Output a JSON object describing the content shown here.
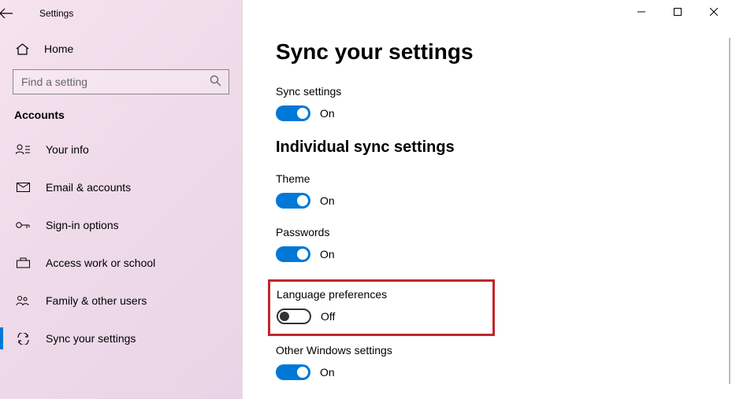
{
  "titlebar": {
    "title": "Settings"
  },
  "sidebar": {
    "home_label": "Home",
    "search_placeholder": "Find a setting",
    "section_label": "Accounts",
    "items": [
      {
        "label": "Your info"
      },
      {
        "label": "Email & accounts"
      },
      {
        "label": "Sign-in options"
      },
      {
        "label": "Access work or school"
      },
      {
        "label": "Family & other users"
      },
      {
        "label": "Sync your settings"
      }
    ]
  },
  "main": {
    "page_title": "Sync your settings",
    "sync_settings": {
      "label": "Sync settings",
      "state": "On"
    },
    "subheading": "Individual sync settings",
    "theme": {
      "label": "Theme",
      "state": "On"
    },
    "passwords": {
      "label": "Passwords",
      "state": "On"
    },
    "language": {
      "label": "Language preferences",
      "state": "Off"
    },
    "other": {
      "label": "Other Windows settings",
      "state": "On"
    }
  }
}
